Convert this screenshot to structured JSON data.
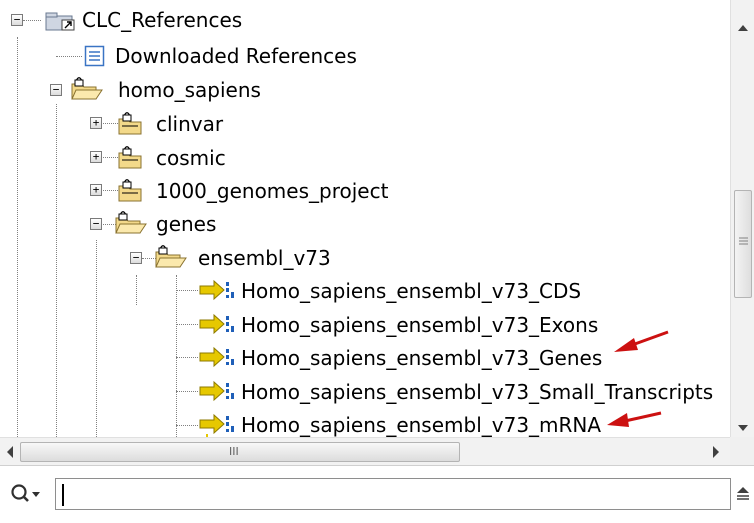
{
  "tree": {
    "root_label": "CLC_References",
    "downloaded_label": "Downloaded References",
    "homo_sapiens_label": "homo_sapiens",
    "clinvar_label": "clinvar",
    "cosmic_label": "cosmic",
    "genomes_label": "1000_genomes_project",
    "genes_label": "genes",
    "ensembl_label": "ensembl_v73",
    "tracks": [
      "Homo_sapiens_ensembl_v73_CDS",
      "Homo_sapiens_ensembl_v73_Exons",
      "Homo_sapiens_ensembl_v73_Genes",
      "Homo_sapiens_ensembl_v73_Small_Transcripts",
      "Homo_sapiens_ensembl_v73_mRNA"
    ]
  },
  "scrollbar": {
    "h_thumb_grip": "III"
  },
  "search": {
    "value": ""
  },
  "colors": {
    "annotation_arrow": "#cc1111",
    "folder": "#f0d070",
    "track_arrow": "#e6c800",
    "track_bars": "#1f5fb8"
  }
}
